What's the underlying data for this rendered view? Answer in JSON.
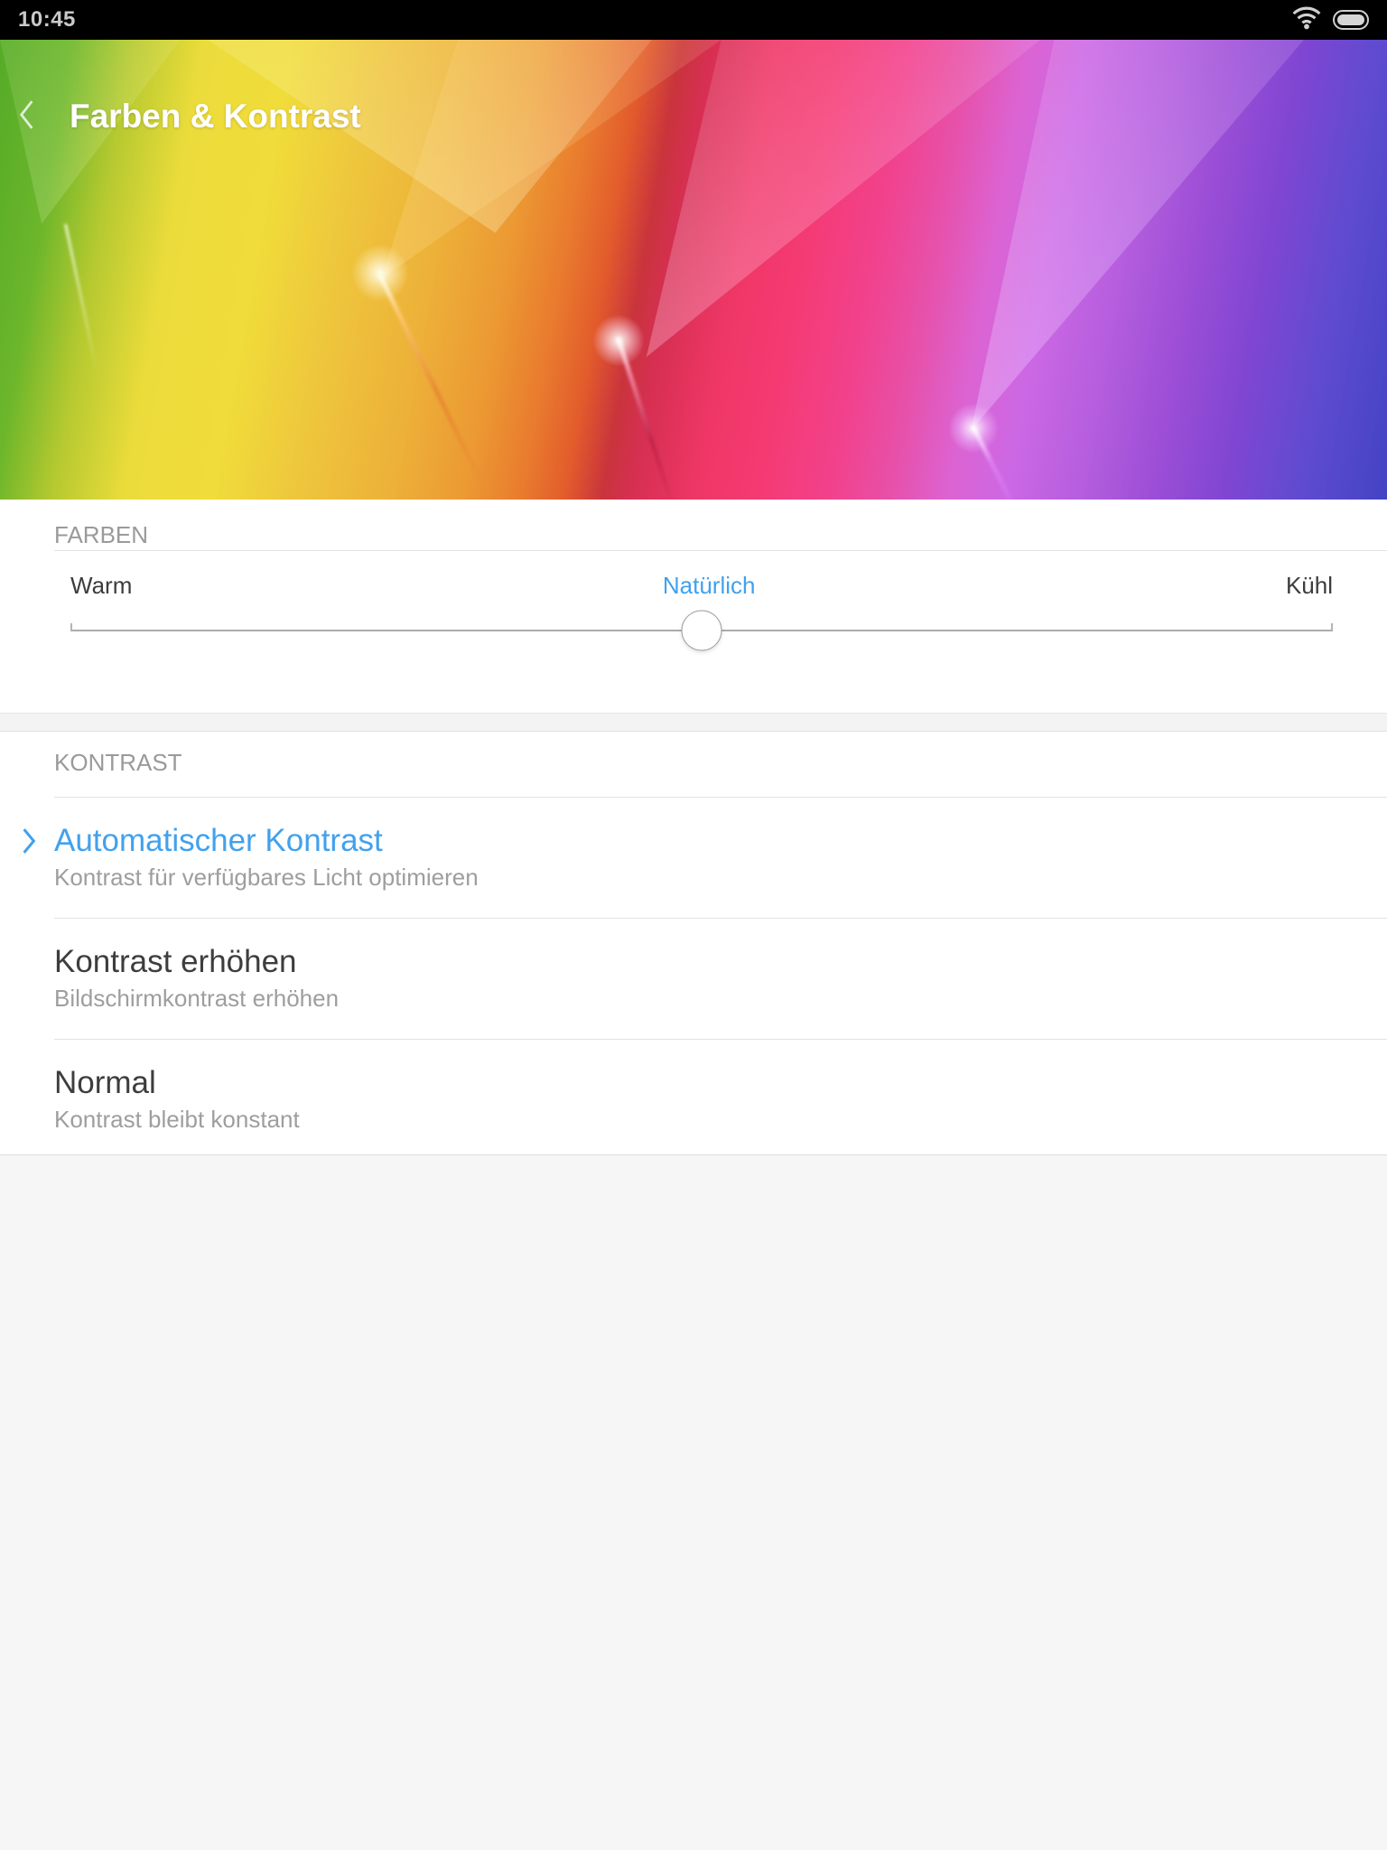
{
  "status_bar": {
    "time": "10:45",
    "wifi_icon": "wifi",
    "battery_icon": "battery-full"
  },
  "header": {
    "back_icon": "back-chevron",
    "title": "Farben & Kontrast"
  },
  "farben": {
    "section_label": "FARBEN",
    "slider": {
      "left_label": "Warm",
      "selected_label": "Natürlich",
      "right_label": "Kühl",
      "value_percent": 50
    }
  },
  "kontrast": {
    "section_label": "KONTRAST",
    "items": [
      {
        "title": "Automatischer Kontrast",
        "subtitle": "Kontrast für verfügbares Licht optimieren",
        "selected": true
      },
      {
        "title": "Kontrast erhöhen",
        "subtitle": "Bildschirmkontrast erhöhen",
        "selected": false
      },
      {
        "title": "Normal",
        "subtitle": "Kontrast bleibt konstant",
        "selected": false
      }
    ]
  },
  "colors": {
    "accent": "#41a1ee",
    "status_bar_bg": "#000000",
    "section_label_text": "#9a9a9a",
    "item_title_text": "#3d3d3d",
    "item_subtitle_text": "#9e9e9e",
    "divider": "#e2e2e2",
    "footer_bg": "#f6f6f6"
  }
}
